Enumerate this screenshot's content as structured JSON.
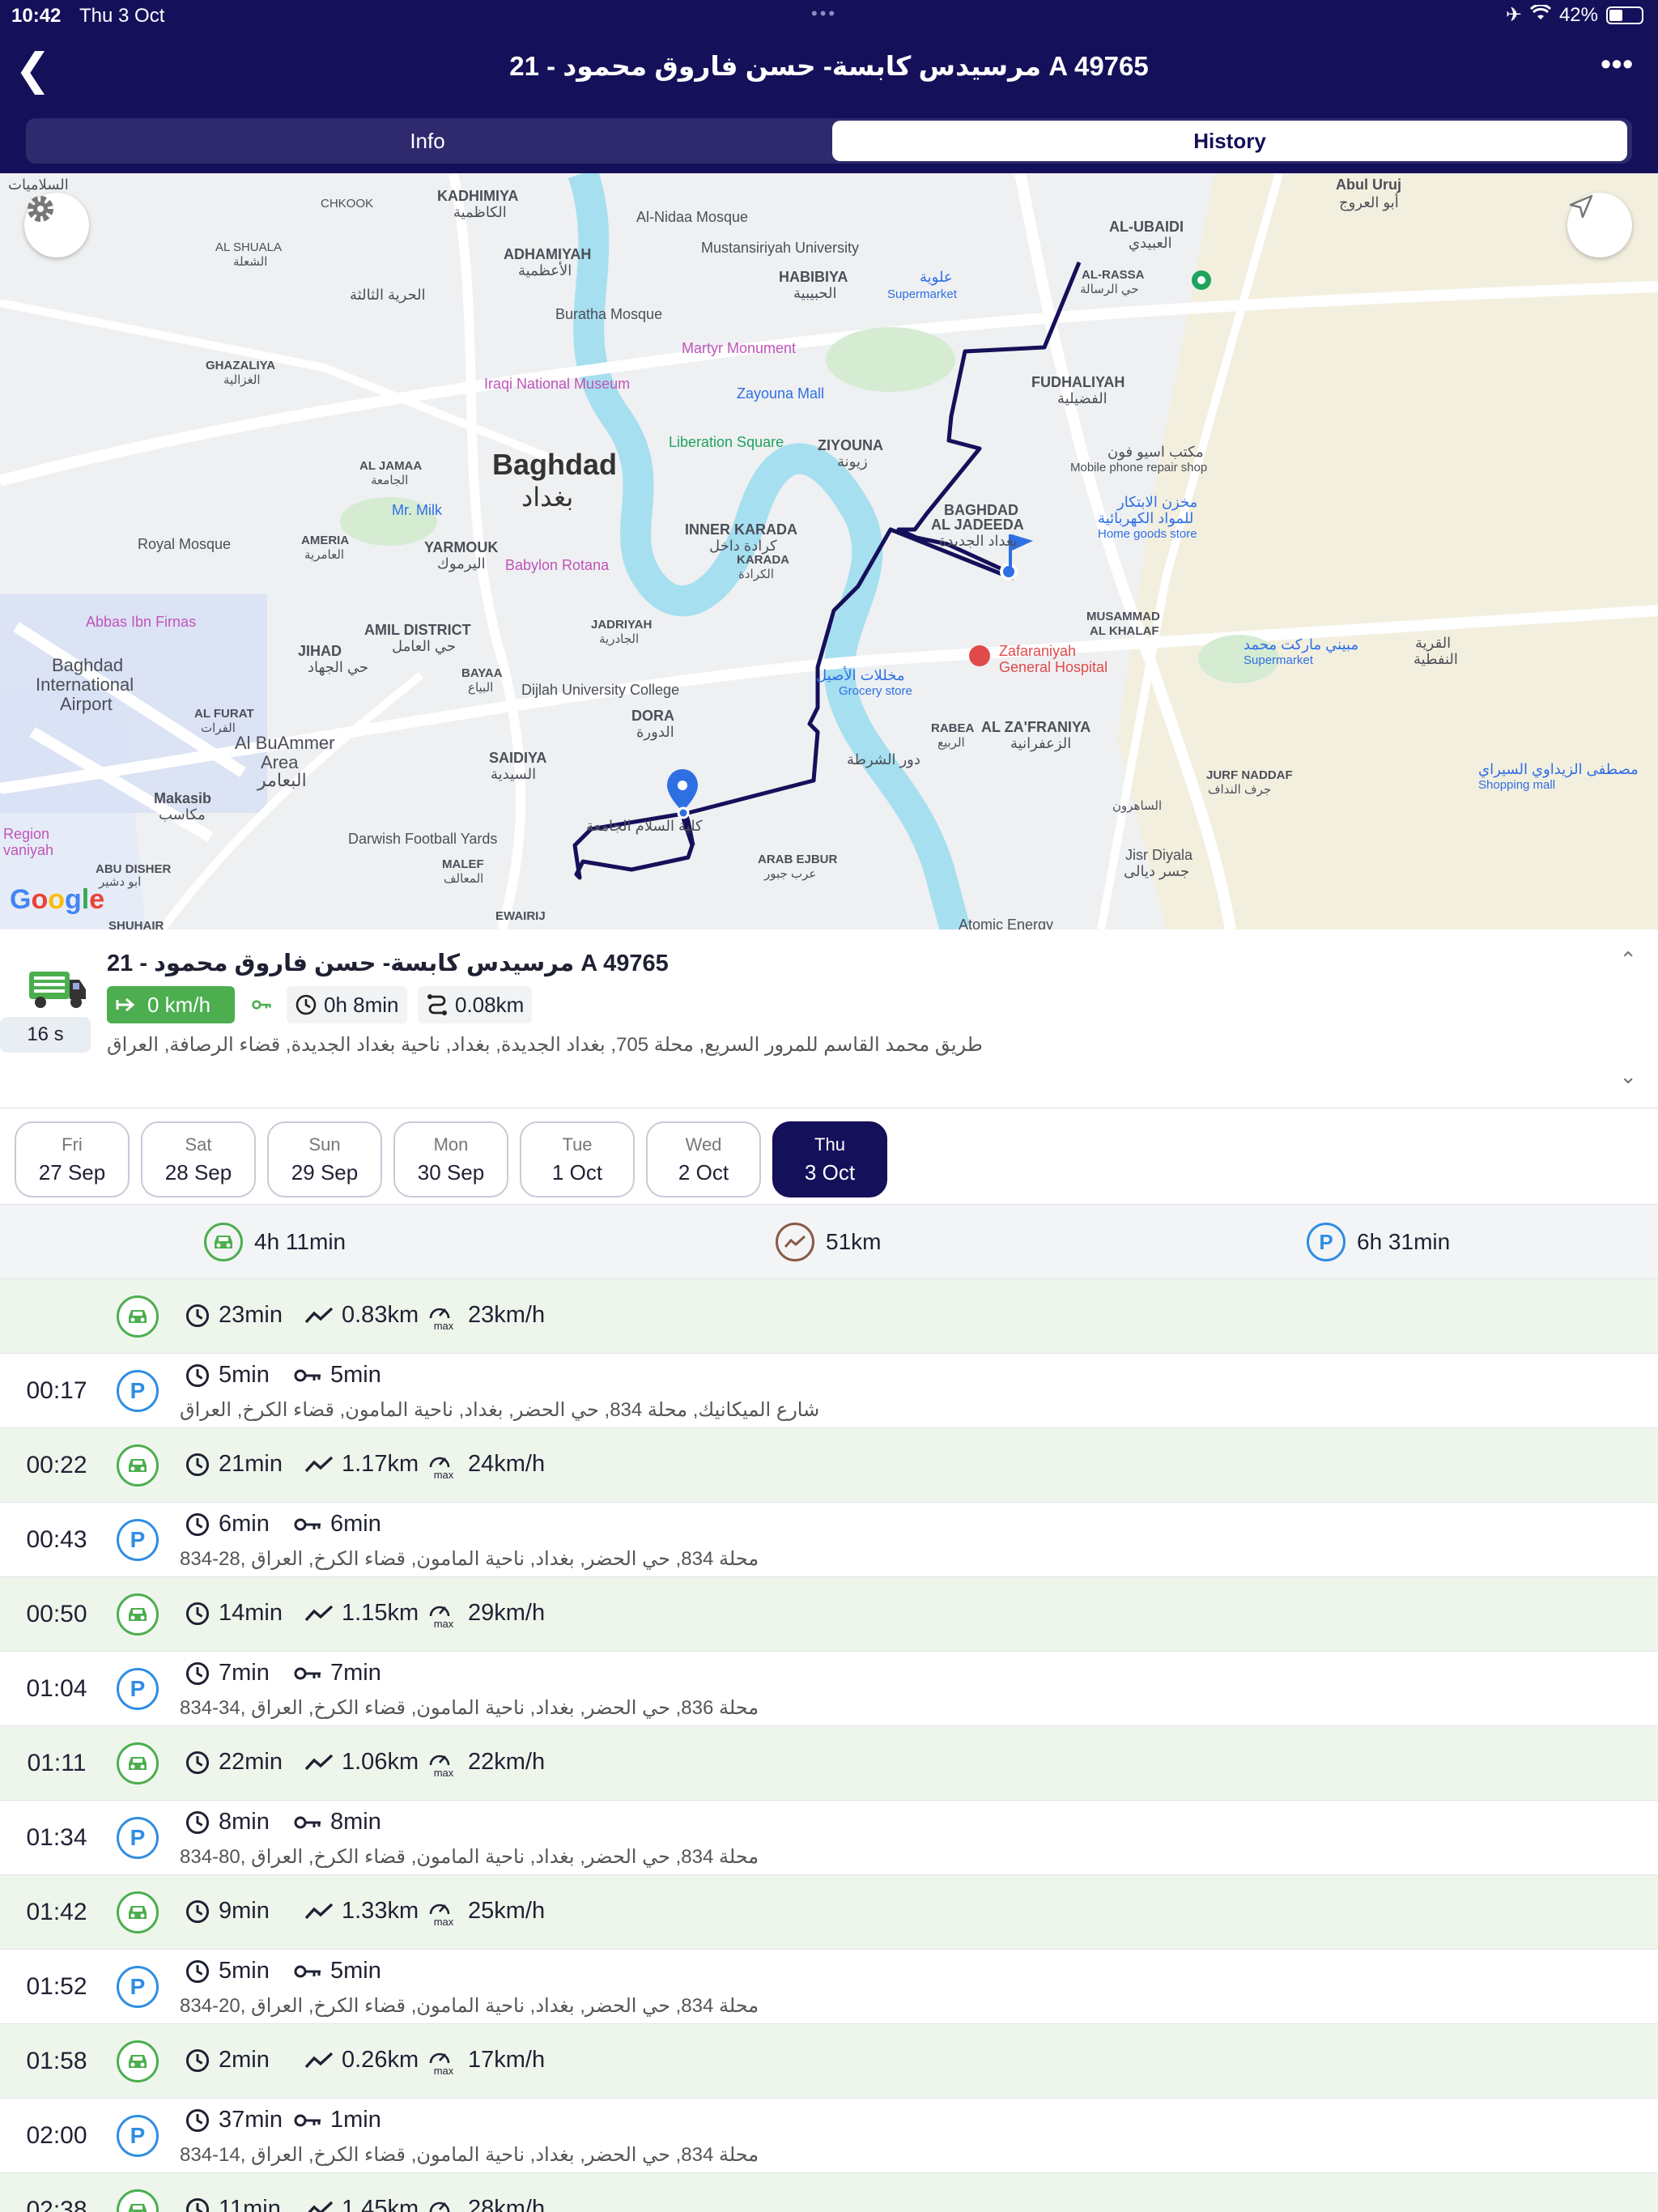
{
  "status_bar": {
    "time": "10:42",
    "date": "Thu 3 Oct",
    "battery": "42%"
  },
  "header": {
    "title": "مرسيدس كابسة- حسن فاروق محمود - 21 A 49765",
    "tabs": [
      "Info",
      "History"
    ],
    "active_tab": "History"
  },
  "map": {
    "attribution": "Google",
    "labels": [
      "السلاميات",
      "CHKOOK",
      "KADHIMIYA",
      "الكاظمية",
      "Al-Nidaa Mosque",
      "Mustansiriyah University",
      "Abul Uruj",
      "أبو العروج",
      "AL-UBAIDI",
      "العبيدي",
      "AL SHUALA",
      "الشعلة",
      "ADHAMIYAH",
      "الأعظمية",
      "HABIBIYA",
      "الحبيبية",
      "علوية",
      "Supermarket",
      "AL-RASSA",
      "حي الرسالة",
      "Buratha Mosque",
      "الحرية الثالثة",
      "Martyr Monument",
      "GHAZALIYA",
      "الغزالية",
      "Zayouna Mall",
      "FUDHALIYAH",
      "الفضيلية",
      "Iraqi National Museum",
      "Liberation Square",
      "ZIYOUNA",
      "زيونة",
      "مكتب اسيو فون",
      "Mobile phone repair shop",
      "AL JAMAA",
      "الجامعة",
      "Baghdad",
      "بغداد",
      "Mr. Milk",
      "BAGHDAD",
      "AL JADEEDA",
      "بغداد الجديدة",
      "مخزن الابتكار",
      "للمواد الكهربائية",
      "Home goods store",
      "Royal Mosque",
      "AMERIA",
      "العامرية",
      "YARMOUK",
      "اليرموك",
      "Babylon Rotana",
      "INNER KARADA",
      "كرادة داخل",
      "KARADA",
      "الكرادة",
      "Abbas Ibn Firnas",
      "AMIL DISTRICT",
      "حي العامل",
      "JADRIYAH",
      "الجادرية",
      "MUSAMMAD",
      "AL KHALAF",
      "Zafaraniyah",
      "General Hospital",
      "مبيني ماركت محمد",
      "Supermarket",
      "القرية",
      "النفطية",
      "Baghdad",
      "International",
      "Airport",
      "JIHAD",
      "حي الجهاد",
      "BAYAA",
      "البياع",
      "Dijlah University College",
      "مخللات الأصيل",
      "Grocery store",
      "AL FURAT",
      "الفرات",
      "DORA",
      "الدورة",
      "RABEA",
      "الربيع",
      "AL ZA'FRANIYA",
      "الزعفرانية",
      "Al BuAmmer",
      "Area",
      "البعامر",
      "SAIDIYA",
      "السيدية",
      "دور الشرطة",
      "JURF NADDAF",
      "جرف النداف",
      "مصطفى الزيداوي السيراي",
      "Shopping mall",
      "Makasib",
      "مكاسب",
      "كلية السلام الجامعة",
      "Darwish Football Yards",
      "الساهرون",
      "Jisr Diyala",
      "جسر ديالى",
      "Region",
      "vaniyah",
      "ABU DISHER",
      "ابو دشير",
      "MALEF",
      "المعالف",
      "ARAB EJBUR",
      "عرب جبور",
      "EWAIRIJ",
      "Atomic Energy",
      "SHUHAIR"
    ]
  },
  "vehicle": {
    "name": "مرسيدس كابسة- حسن فاروق محمود - 21 A 49765",
    "last_update": "16 s",
    "speed": "0 km/h",
    "duration": "0h 8min",
    "distance": "0.08km",
    "address": "طريق محمد القاسم للمرور السريع, محلة 705, بغداد الجديدة, بغداد, ناحية بغداد الجديدة, قضاء الرصافة, العراق"
  },
  "days": [
    {
      "name": "Fri",
      "date": "27 Sep",
      "selected": false
    },
    {
      "name": "Sat",
      "date": "28 Sep",
      "selected": false
    },
    {
      "name": "Sun",
      "date": "29 Sep",
      "selected": false
    },
    {
      "name": "Mon",
      "date": "30 Sep",
      "selected": false
    },
    {
      "name": "Tue",
      "date": "1 Oct",
      "selected": false
    },
    {
      "name": "Wed",
      "date": "2 Oct",
      "selected": false
    },
    {
      "name": "Thu",
      "date": "3 Oct",
      "selected": true
    }
  ],
  "summary": {
    "drive_time": "4h 11min",
    "distance": "51km",
    "park_time": "6h 31min"
  },
  "history": [
    {
      "type": "drive",
      "time": "",
      "duration": "23min",
      "distance": "0.83km",
      "max_speed": "23km/h"
    },
    {
      "type": "park",
      "time": "00:17",
      "duration": "5min",
      "engine": "5min",
      "address": "شارع الميكانيك, محلة 834, حي الحضر, بغداد, ناحية المامون, قضاء الكرخ, العراق"
    },
    {
      "type": "drive",
      "time": "00:22",
      "duration": "21min",
      "distance": "1.17km",
      "max_speed": "24km/h"
    },
    {
      "type": "park",
      "time": "00:43",
      "duration": "6min",
      "engine": "6min",
      "address": "834-28, محلة 834, حي الحضر, بغداد, ناحية المامون, قضاء الكرخ, العراق"
    },
    {
      "type": "drive",
      "time": "00:50",
      "duration": "14min",
      "distance": "1.15km",
      "max_speed": "29km/h"
    },
    {
      "type": "park",
      "time": "01:04",
      "duration": "7min",
      "engine": "7min",
      "address": "834-34, محلة 836, حي الحضر, بغداد, ناحية المامون, قضاء الكرخ, العراق"
    },
    {
      "type": "drive",
      "time": "01:11",
      "duration": "22min",
      "distance": "1.06km",
      "max_speed": "22km/h"
    },
    {
      "type": "park",
      "time": "01:34",
      "duration": "8min",
      "engine": "8min",
      "address": "834-80, محلة 834, حي الحضر, بغداد, ناحية المامون, قضاء الكرخ, العراق"
    },
    {
      "type": "drive",
      "time": "01:42",
      "duration": "9min",
      "distance": "1.33km",
      "max_speed": "25km/h"
    },
    {
      "type": "park",
      "time": "01:52",
      "duration": "5min",
      "engine": "5min",
      "address": "834-20, محلة 834, حي الحضر, بغداد, ناحية المامون, قضاء الكرخ, العراق"
    },
    {
      "type": "drive",
      "time": "01:58",
      "duration": "2min",
      "distance": "0.26km",
      "max_speed": "17km/h"
    },
    {
      "type": "park",
      "time": "02:00",
      "duration": "37min",
      "engine": "1min",
      "address": "834-14, محلة 834, حي الحضر, بغداد, ناحية المامون, قضاء الكرخ, العراق"
    },
    {
      "type": "drive",
      "time": "02:38",
      "duration": "11min",
      "distance": "1.45km",
      "max_speed": "28km/h"
    }
  ],
  "labels": {
    "max": "max"
  },
  "colors": {
    "navy": "#15105a",
    "drive_green": "#4cae4f",
    "park_blue": "#2f8de4",
    "route": "#15105a"
  }
}
